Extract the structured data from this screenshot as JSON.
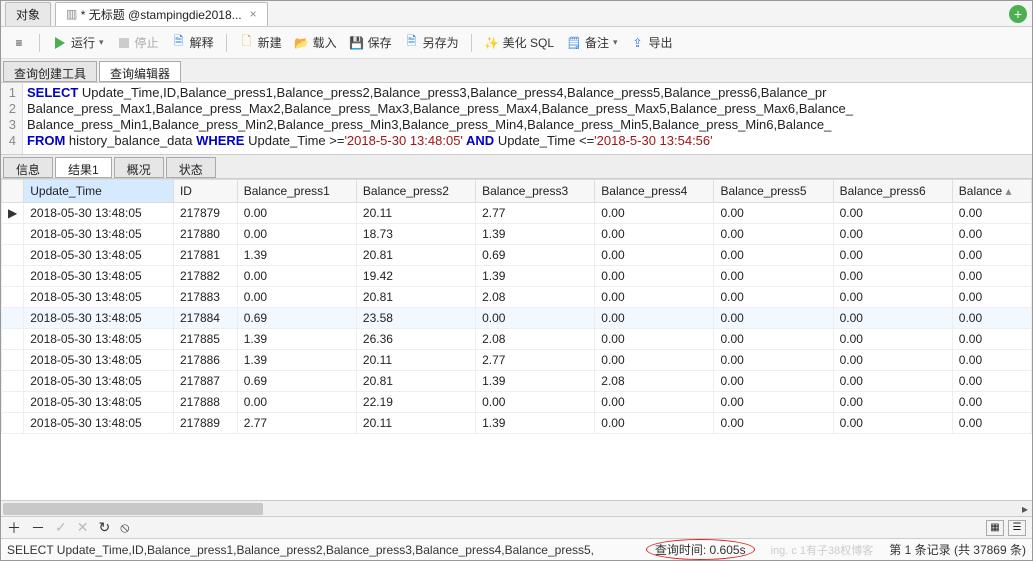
{
  "tabs": {
    "object": "对象",
    "main_icon": "▥",
    "main": "* 无标题 @stampingdie2018..."
  },
  "toolbar": {
    "run": "运行",
    "stop": "停止",
    "explain": "解释",
    "new": "新建",
    "load": "载入",
    "save": "保存",
    "saveas": "另存为",
    "beautify": "美化 SQL",
    "note": "备注",
    "export": "导出"
  },
  "subtabs": {
    "builder": "查询创建工具",
    "editor": "查询编辑器"
  },
  "sql": {
    "l1a": "SELECT",
    "l1b": " Update_Time,ID,Balance_press1,Balance_press2,Balance_press3,Balance_press4,Balance_press5,Balance_press6,Balance_pr",
    "l2": "Balance_press_Max1,Balance_press_Max2,Balance_press_Max3,Balance_press_Max4,Balance_press_Max5,Balance_press_Max6,Balance_",
    "l3": "Balance_press_Min1,Balance_press_Min2,Balance_press_Min3,Balance_press_Min4,Balance_press_Min5,Balance_press_Min6,Balance_",
    "l4a": "FROM",
    "l4b": " history_balance_data ",
    "l4c": "WHERE",
    "l4d": " Update_Time >=",
    "l4e": "'2018-5-30 13:48:05'",
    "l4f": " AND",
    "l4g": " Update_Time <=",
    "l4h": "'2018-5-30 13:54:56'"
  },
  "gutter": [
    "1",
    "2",
    "3",
    "4"
  ],
  "midtabs": {
    "info": "信息",
    "result": "结果1",
    "profile": "概况",
    "status": "状态"
  },
  "cols": [
    "Update_Time",
    "ID",
    "Balance_press1",
    "Balance_press2",
    "Balance_press3",
    "Balance_press4",
    "Balance_press5",
    "Balance_press6",
    "Balance"
  ],
  "rows": [
    {
      "t": "2018-05-30 13:48:05",
      "id": "217879",
      "p1": "0.00",
      "p2": "20.11",
      "p3": "2.77",
      "p4": "0.00",
      "p5": "0.00",
      "p6": "0.00",
      "p7": "0.00"
    },
    {
      "t": "2018-05-30 13:48:05",
      "id": "217880",
      "p1": "0.00",
      "p2": "18.73",
      "p3": "1.39",
      "p4": "0.00",
      "p5": "0.00",
      "p6": "0.00",
      "p7": "0.00"
    },
    {
      "t": "2018-05-30 13:48:05",
      "id": "217881",
      "p1": "1.39",
      "p2": "20.81",
      "p3": "0.69",
      "p4": "0.00",
      "p5": "0.00",
      "p6": "0.00",
      "p7": "0.00"
    },
    {
      "t": "2018-05-30 13:48:05",
      "id": "217882",
      "p1": "0.00",
      "p2": "19.42",
      "p3": "1.39",
      "p4": "0.00",
      "p5": "0.00",
      "p6": "0.00",
      "p7": "0.00"
    },
    {
      "t": "2018-05-30 13:48:05",
      "id": "217883",
      "p1": "0.00",
      "p2": "20.81",
      "p3": "2.08",
      "p4": "0.00",
      "p5": "0.00",
      "p6": "0.00",
      "p7": "0.00"
    },
    {
      "t": "2018-05-30 13:48:05",
      "id": "217884",
      "p1": "0.69",
      "p2": "23.58",
      "p3": "0.00",
      "p4": "0.00",
      "p5": "0.00",
      "p6": "0.00",
      "p7": "0.00",
      "hl": true
    },
    {
      "t": "2018-05-30 13:48:05",
      "id": "217885",
      "p1": "1.39",
      "p2": "26.36",
      "p3": "2.08",
      "p4": "0.00",
      "p5": "0.00",
      "p6": "0.00",
      "p7": "0.00"
    },
    {
      "t": "2018-05-30 13:48:05",
      "id": "217886",
      "p1": "1.39",
      "p2": "20.11",
      "p3": "2.77",
      "p4": "0.00",
      "p5": "0.00",
      "p6": "0.00",
      "p7": "0.00"
    },
    {
      "t": "2018-05-30 13:48:05",
      "id": "217887",
      "p1": "0.69",
      "p2": "20.81",
      "p3": "1.39",
      "p4": "2.08",
      "p5": "0.00",
      "p6": "0.00",
      "p7": "0.00"
    },
    {
      "t": "2018-05-30 13:48:05",
      "id": "217888",
      "p1": "0.00",
      "p2": "22.19",
      "p3": "0.00",
      "p4": "0.00",
      "p5": "0.00",
      "p6": "0.00",
      "p7": "0.00"
    },
    {
      "t": "2018-05-30 13:48:05",
      "id": "217889",
      "p1": "2.77",
      "p2": "20.11",
      "p3": "1.39",
      "p4": "0.00",
      "p5": "0.00",
      "p6": "0.00",
      "p7": "0.00"
    }
  ],
  "footer_sql": "SELECT Update_Time,ID,Balance_press1,Balance_press2,Balance_press3,Balance_press4,Balance_press5,",
  "query_time_label": "查询时间: 0.605s",
  "record_label": "第 1 条记录 (共 37869 条)",
  "watermark": "ing. c 1有子38权博客"
}
